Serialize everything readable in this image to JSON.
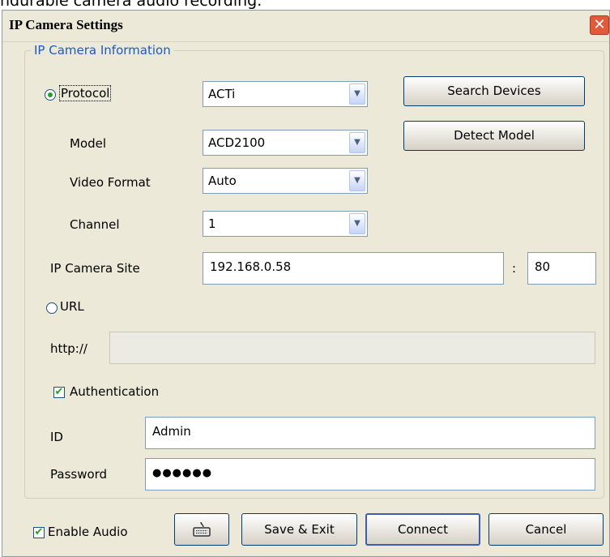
{
  "caption": "ndurable camera audio recording.",
  "window": {
    "title": "IP Camera Settings",
    "close_glyph": "✕"
  },
  "group": {
    "label": "IP Camera Information"
  },
  "protocol": {
    "label": "Protocol",
    "value": "ACTi",
    "selected": true
  },
  "model": {
    "label": "Model",
    "value": "ACD2100"
  },
  "video_format": {
    "label": "Video Format",
    "value": "Auto"
  },
  "channel": {
    "label": "Channel",
    "value": "1"
  },
  "buttons": {
    "search": "Search Devices",
    "detect": "Detect Model",
    "save": "Save & Exit",
    "connect": "Connect",
    "cancel": "Cancel"
  },
  "site": {
    "label": "IP Camera Site",
    "ip": "192.168.0.58",
    "separator": ":",
    "port": "80"
  },
  "url": {
    "label": "URL",
    "prefix": "http://",
    "value": "",
    "selected": false
  },
  "auth": {
    "label": "Authentication",
    "checked": true
  },
  "id": {
    "label": "ID",
    "value": "Admin"
  },
  "password": {
    "label": "Password",
    "value": "●●●●●●"
  },
  "audio": {
    "label": "Enable Audio",
    "checked": true
  },
  "icons": {
    "keyboard": "keyboard-icon",
    "arrow": "▼",
    "check": "✔"
  },
  "colors": {
    "accent": "#1e58c7",
    "check": "#21a121",
    "close": "#e15a3a"
  }
}
